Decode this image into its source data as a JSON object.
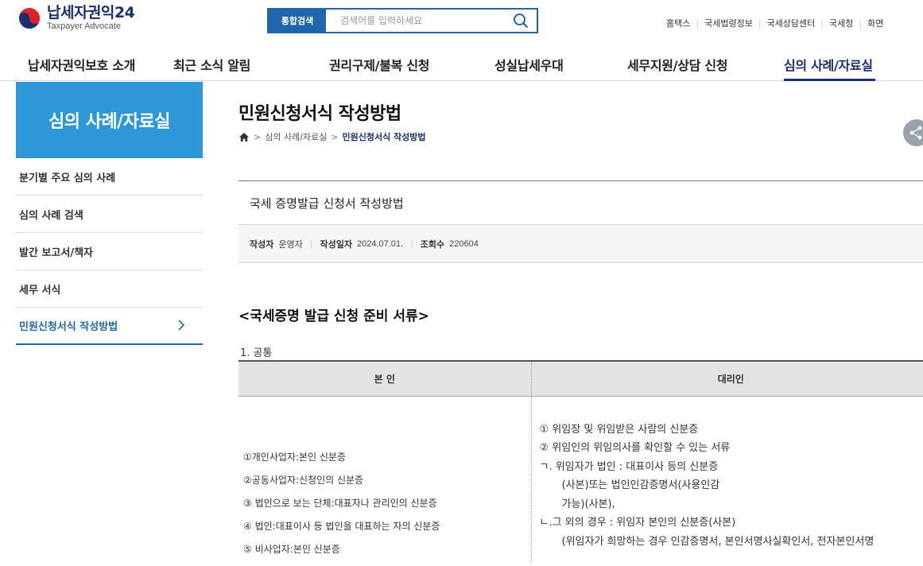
{
  "header": {
    "logo_title": "납세자권익24",
    "logo_sub": "Taxpayer Advocate",
    "search_tag": "통합검색",
    "search_placeholder": "검색어를 입력하세요",
    "util_links": [
      "홈택스",
      "국세법령정보",
      "국세상담센터",
      "국세청",
      "화면"
    ]
  },
  "gnb": [
    "납세자권익보호 소개",
    "최근 소식 알림",
    "권리구제/불복 신청",
    "성실납세우대",
    "세무지원/상담 신청",
    "심의 사례/자료실"
  ],
  "sidebar": {
    "title": "심의 사례/자료실",
    "items": [
      "분기별 주요 심의 사례",
      "심의 사례 검색",
      "발간 보고서/책자",
      "세무 서식",
      "민원신청서식 작성방법"
    ]
  },
  "page": {
    "title": "민원신청서식 작성방법",
    "breadcrumb_section": "심의 사례/자료실",
    "breadcrumb_current": "민원신청서식 작성방법"
  },
  "post": {
    "title": "국세 증명발급 신청서 작성방법",
    "author_label": "작성자",
    "author": "운영자",
    "date_label": "작성일자",
    "date": "2024.07.01.",
    "views_label": "조회수",
    "views": "220604"
  },
  "content": {
    "section_heading": "<국세증명 발급 신청 준비 서류>",
    "subheading": "1. 공통",
    "table": {
      "headers": [
        "본 인",
        "대리인"
      ],
      "left": [
        "①개인사업자:본인 신분증",
        "②공동사업자:신청인의 신분증",
        "③ 법인으로 보는 단체:대표자나 관리인의 신분증",
        "④ 법인:대표이사 등 법인을 대표하는 자의 신분증",
        "⑤ 비사업자:본인 신분증"
      ],
      "right": [
        "① 위임장 및 위임받은 사람의 신분증",
        "② 위임인의 위임의사를 확인할 수 있는 서류",
        "ㄱ. 위임자가 법인 : 대표이사 등의 신분증",
        "(사본)또는 법인인감증명서(사용인감",
        "가능)(사본),",
        "ㄴ.그 외의 경우 : 위임자 본인의 신분증(사본)",
        "(위임자가 희망하는 경우 인감증명서, 본인서명사실확인서, 전자본인서명"
      ]
    }
  },
  "colors": {
    "navy": "#1b2f6e",
    "blue": "#1f66ad",
    "sidebar_title_bg": "#2e97d8",
    "logo_red": "#d8232a"
  },
  "icons": [
    "logo-mark-icon",
    "search-icon",
    "home-icon",
    "share-icon",
    "chevron-right-icon"
  ]
}
